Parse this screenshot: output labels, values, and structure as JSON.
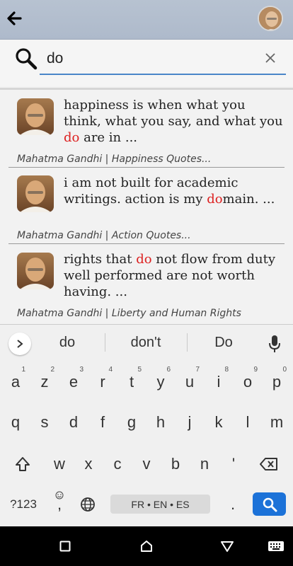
{
  "appbar": {
    "back_icon": "arrow-left-icon",
    "avatar_icon": "profile-avatar"
  },
  "search": {
    "value": "do",
    "icon": "magnifier-icon",
    "clear_icon": "close-icon"
  },
  "results": [
    {
      "quote_before": "happiness is when what you think, what you say, and what you ",
      "quote_highlight": "do",
      "quote_after": " are in ...",
      "source": "Mahatma Gandhi | Happiness Quotes..."
    },
    {
      "quote_before": "i am not built for academic writings. action is my ",
      "quote_highlight": "do",
      "quote_after": "main. ...",
      "source": "Mahatma Gandhi | Action Quotes..."
    },
    {
      "quote_before": "rights that ",
      "quote_highlight": "do",
      "quote_after": " not flow from duty well performed are not worth having. ...",
      "source": "Mahatma Gandhi | Liberty and Human Rights"
    }
  ],
  "keyboard": {
    "suggestions": [
      "do",
      "don't",
      "Do"
    ],
    "row1": [
      {
        "k": "a",
        "n": "1"
      },
      {
        "k": "z",
        "n": "2"
      },
      {
        "k": "e",
        "n": "3"
      },
      {
        "k": "r",
        "n": "4"
      },
      {
        "k": "t",
        "n": "5"
      },
      {
        "k": "y",
        "n": "6"
      },
      {
        "k": "u",
        "n": "7"
      },
      {
        "k": "i",
        "n": "8"
      },
      {
        "k": "o",
        "n": "9"
      },
      {
        "k": "p",
        "n": "0"
      }
    ],
    "row2": [
      "q",
      "s",
      "d",
      "f",
      "g",
      "h",
      "j",
      "k",
      "l",
      "m"
    ],
    "row3": [
      "w",
      "x",
      "c",
      "v",
      "b",
      "n",
      "'"
    ],
    "symbols_label": "?123",
    "comma_label": ",",
    "space_label": "FR • EN • ES",
    "period_label": ".",
    "accent_color": "#1c72d8"
  },
  "navbar": {
    "icons": [
      "recents-square-icon",
      "home-icon",
      "back-triangle-icon",
      "keyboard-icon"
    ]
  }
}
